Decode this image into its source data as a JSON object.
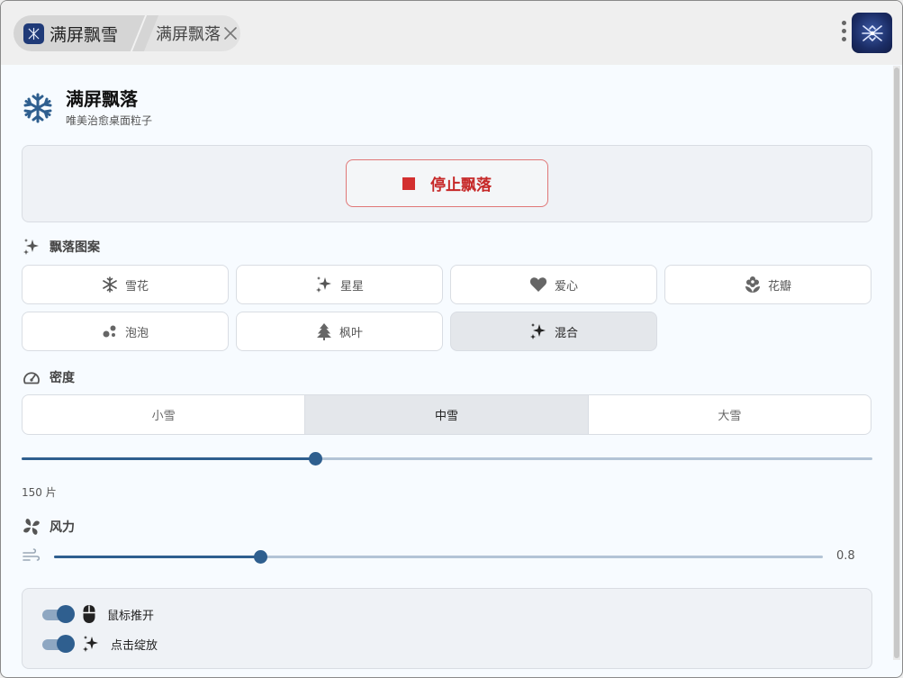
{
  "titlebar": {
    "active_tab_label": "满屏飘雪",
    "inactive_tab_label": "满屏飘落"
  },
  "header": {
    "title": "满屏飘落",
    "subtitle": "唯美治愈桌面粒子"
  },
  "action": {
    "stop_label": "停止飘落"
  },
  "patterns": {
    "label": "飘落图案",
    "items": [
      {
        "label": "雪花",
        "icon": "snowflake-icon"
      },
      {
        "label": "星星",
        "icon": "sparkle-icon"
      },
      {
        "label": "爱心",
        "icon": "heart-icon"
      },
      {
        "label": "花瓣",
        "icon": "flower-icon"
      },
      {
        "label": "泡泡",
        "icon": "bubbles-icon"
      },
      {
        "label": "枫叶",
        "icon": "tree-icon"
      },
      {
        "label": "混合",
        "icon": "sparkle-icon"
      }
    ],
    "selected": "混合"
  },
  "density": {
    "label": "密度",
    "options": [
      "小雪",
      "中雪",
      "大雪"
    ],
    "selected": "中雪",
    "slider_fraction": 0.345,
    "count_text": "150 片"
  },
  "wind": {
    "label": "风力",
    "value": "0.8",
    "slider_fraction": 0.268
  },
  "toggles": [
    {
      "label": "鼠标推开",
      "on": true,
      "icon": "mouse-icon"
    },
    {
      "label": "点击绽放",
      "on": true,
      "icon": "sparkle-icon"
    }
  ],
  "colors": {
    "accent": "#2f5f8f",
    "stop_red": "#d32f2f",
    "background": "#f7fbff"
  }
}
